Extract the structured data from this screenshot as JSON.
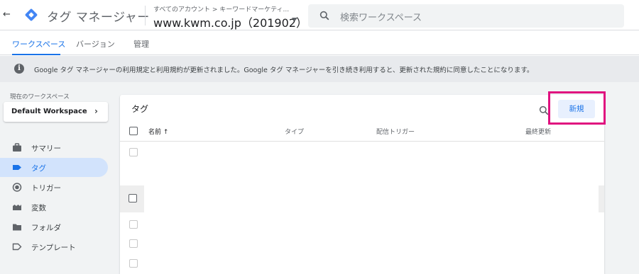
{
  "header": {
    "product_name": "タグ マネージャー",
    "breadcrumb": "すべてのアカウント > キーワードマーケティ...",
    "container_name": "www.kwm.co.jp（201902）",
    "search_placeholder": "検索ワークスペース",
    "brand_color": "#1a73e8"
  },
  "tabs": [
    {
      "label": "ワークスペース",
      "active": true
    },
    {
      "label": "バージョン",
      "active": false
    },
    {
      "label": "管理",
      "active": false
    }
  ],
  "notice": {
    "text": "Google タグ マネージャーの利用規定と利用規約が更新されました。Google タグ マネージャーを引き続き利用すると、更新された規約に同意したことになります。"
  },
  "sidebar": {
    "workspace_label": "現在のワークスペース",
    "workspace_name": "Default Workspace",
    "items": [
      {
        "label": "サマリー",
        "icon": "briefcase-icon"
      },
      {
        "label": "タグ",
        "icon": "tag-icon",
        "active": true
      },
      {
        "label": "トリガー",
        "icon": "trigger-icon"
      },
      {
        "label": "変数",
        "icon": "variables-icon"
      },
      {
        "label": "フォルダ",
        "icon": "folder-icon"
      },
      {
        "label": "テンプレート",
        "icon": "template-icon"
      }
    ]
  },
  "tags_panel": {
    "title": "タグ",
    "new_button": "新規",
    "columns": {
      "name": "名前 ↑",
      "type": "タイプ",
      "trigger": "配信トリガー",
      "updated": "最終更新"
    },
    "highlight_color": "#e0117f"
  }
}
